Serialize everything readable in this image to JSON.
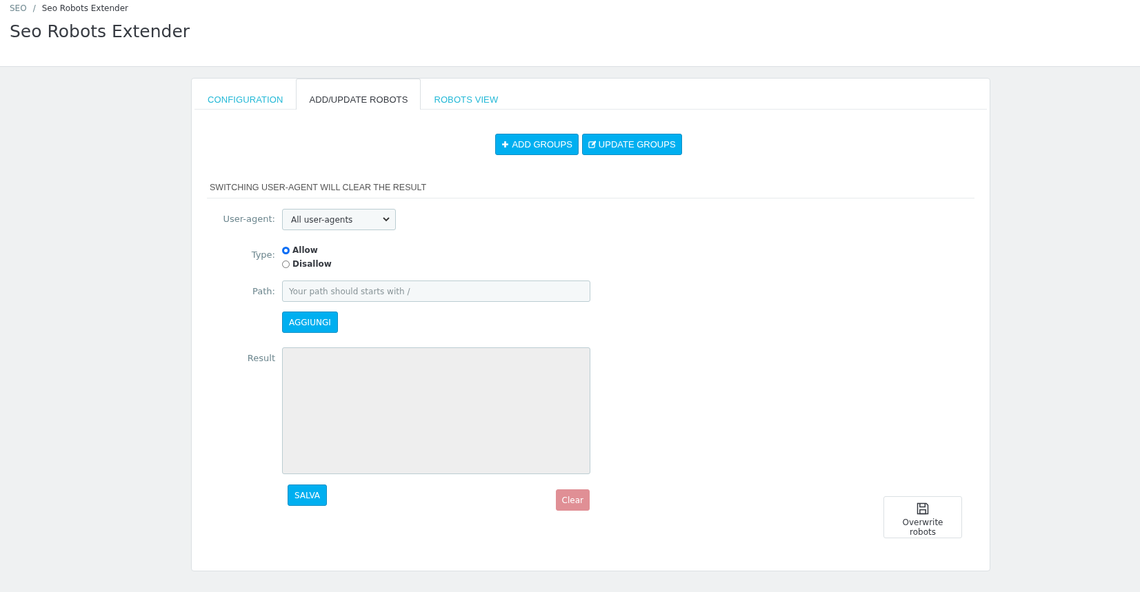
{
  "breadcrumb": {
    "items": [
      "SEO",
      "Seo Robots Extender"
    ],
    "separator": "/"
  },
  "page_title": "Seo Robots Extender",
  "tabs": [
    {
      "label": "CONFIGURATION",
      "selected": false
    },
    {
      "label": "ADD/UPDATE ROBOTS",
      "selected": true
    },
    {
      "label": "ROBOTS VIEW",
      "selected": false
    }
  ],
  "group_buttons": [
    {
      "label": "ADD GROUPS",
      "kind": "add"
    },
    {
      "label": "UPDATE GROUPS",
      "kind": "edit"
    }
  ],
  "section_heading": "SWITCHING USER-AGENT WILL CLEAR THE RESULT",
  "form": {
    "user_agent": {
      "label": "User-agent:",
      "value": "All user-agents"
    },
    "type": {
      "label": "Type:",
      "options": [
        {
          "label": "Allow",
          "selected": true
        },
        {
          "label": "Disallow",
          "selected": false
        }
      ]
    },
    "path": {
      "label": "Path:",
      "placeholder": "Your path should starts with /"
    },
    "add_button": "AGGIUNGI",
    "result": {
      "label": "Result"
    },
    "save_button": "SALVA",
    "clear_button": "Clear"
  },
  "overwrite_button": "Overwrite robots"
}
